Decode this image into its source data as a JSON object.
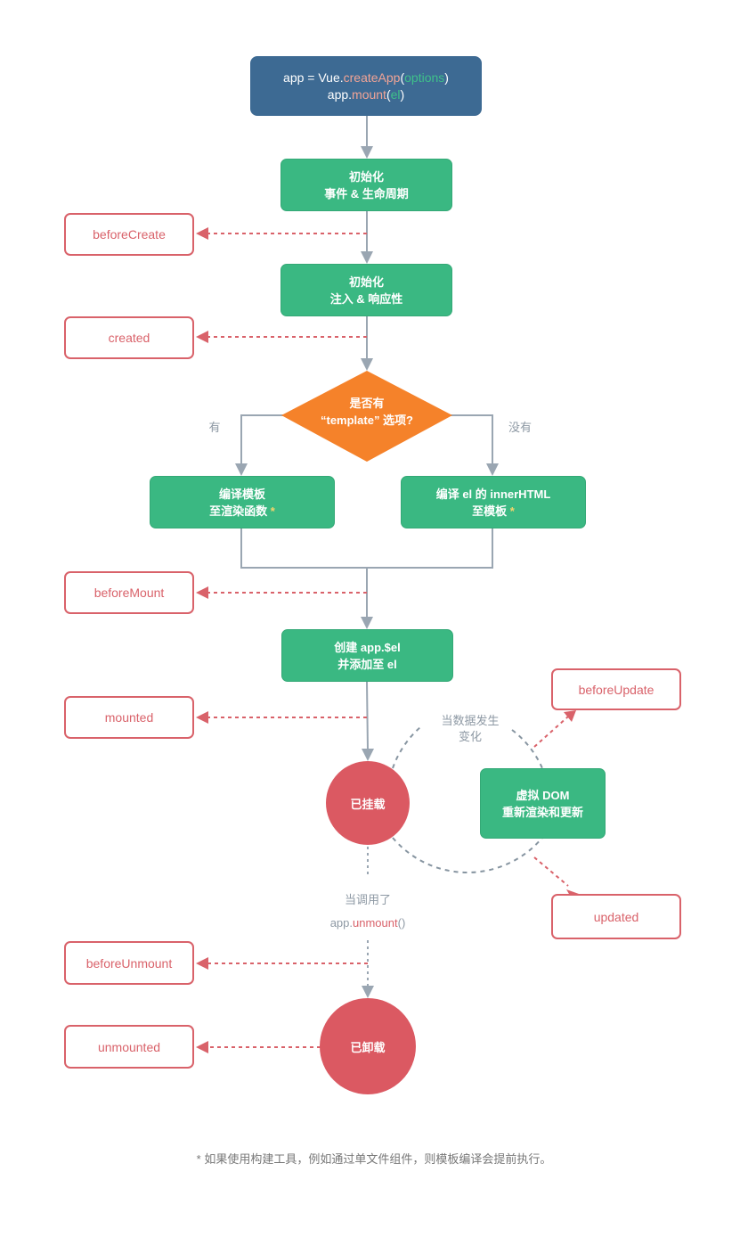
{
  "start": {
    "line1": {
      "a": "app = Vue.",
      "b": "createApp",
      "c": "(",
      "d": "options",
      "e": ")"
    },
    "line2": {
      "a": "app.",
      "b": "mount",
      "c": "(",
      "d": "el",
      "e": ")"
    }
  },
  "steps": {
    "init_events": {
      "line1": "初始化",
      "line2": "事件 & 生命周期"
    },
    "init_inject": {
      "line1": "初始化",
      "line2": "注入 & 响应性"
    },
    "compile_template": {
      "line1": "编译模板",
      "line2": "至渲染函数",
      "star": "*"
    },
    "compile_el": {
      "line1": "编译 el 的 innerHTML",
      "line2": "至模板",
      "star": "*"
    },
    "create_el": {
      "line1": "创建 app.$el",
      "line2": "并添加至 el"
    },
    "vdom": {
      "line1": "虚拟 DOM",
      "line2": "重新渲染和更新"
    }
  },
  "decision": {
    "line1": "是否有",
    "line2": "“template” 选项?",
    "yes": "有",
    "no": "没有"
  },
  "hooks": {
    "beforeCreate": "beforeCreate",
    "created": "created",
    "beforeMount": "beforeMount",
    "mounted": "mounted",
    "beforeUpdate": "beforeUpdate",
    "updated": "updated",
    "beforeUnmount": "beforeUnmount",
    "unmounted": "unmounted"
  },
  "states": {
    "mounted": "已挂载",
    "unmounted": "已卸载"
  },
  "labels": {
    "data_change_line1": "当数据发生",
    "data_change_line2": "变化",
    "unmount_call_line1": "当调用了",
    "unmount_call_a": "app.",
    "unmount_call_b": "unmount",
    "unmount_call_c": "()"
  },
  "footnote": "* 如果使用构建工具，例如通过单文件组件，则模板编译会提前执行。",
  "colors": {
    "start": "#3d6a93",
    "step": "#3ab882",
    "decision": "#f5822a",
    "hook": "#d9626a",
    "state": "#db5962",
    "connector": "#9aa6b2"
  }
}
